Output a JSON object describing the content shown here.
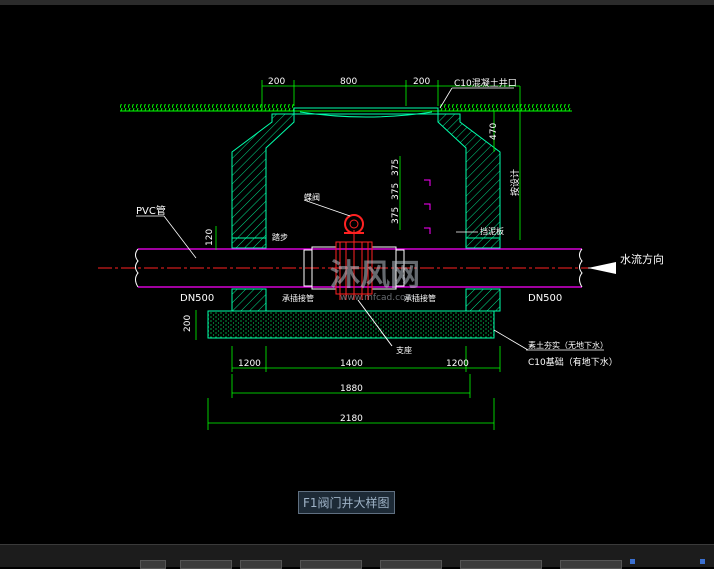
{
  "drawing": {
    "dims_top": [
      "200",
      "800",
      "200"
    ],
    "cover_note": "C10混凝土井口",
    "dim_470": "470",
    "dim_depth_note": "按设计",
    "dim_375": [
      "375",
      "375",
      "375"
    ],
    "dim_120": "120",
    "dim_200_left": "200",
    "label_pvc": "PVC管",
    "label_valve": "蝶阀",
    "label_step": "踏步",
    "label_seal": "挡泥板",
    "label_flow": "水流方向",
    "label_dn_left": "DN500",
    "label_dn_right": "DN500",
    "label_joint_left": "承插接管",
    "label_joint_right": "承插接管",
    "label_support": "支座",
    "label_sand": "素土夯实（无地下水）",
    "label_c10": "C10基础（有地下水）",
    "dims_bottom": [
      "1200",
      "1400",
      "1200"
    ],
    "dim_1880": "1880",
    "dim_2180": "2180"
  },
  "watermark": {
    "text": "沐风网",
    "url": "www.mfcad.com"
  },
  "caption": "F1阀门井大样图",
  "colors": {
    "background": "#000000",
    "dimension": "#00ff00",
    "wall_hatch": "#00ffaa",
    "pipe": "#ff00ff",
    "centerline": "#ff2222",
    "valve": "#ff2222",
    "text": "#ffffff",
    "ground": "#00ff00"
  }
}
